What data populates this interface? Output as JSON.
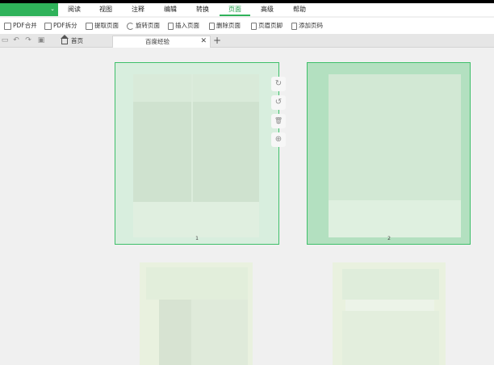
{
  "menubar": {
    "items": [
      "阅读",
      "视图",
      "注释",
      "编辑",
      "转换",
      "页面",
      "高级",
      "帮助"
    ],
    "active": "页面",
    "accent_color": "#2fb25a"
  },
  "toolbar": {
    "merge_pdf": "PDF合并",
    "split_pdf": "PDF拆分",
    "extract_page": "提取页面",
    "rotate_page": "旋转页面",
    "insert_page": "插入页面",
    "delete_page": "删除页面",
    "header_footer": "页眉页脚",
    "add_page_number": "添加页码"
  },
  "tabs": {
    "home": "首页",
    "document": "百度经验",
    "close_icon": "✕",
    "add_icon": "+"
  },
  "thumbnails": {
    "page1_number": "1",
    "page2_number": "2"
  },
  "page_actions": {
    "rotate_cw_icon": "↻",
    "rotate_ccw_icon": "↺",
    "delete_icon": "🗑",
    "add_icon": "⊕"
  }
}
